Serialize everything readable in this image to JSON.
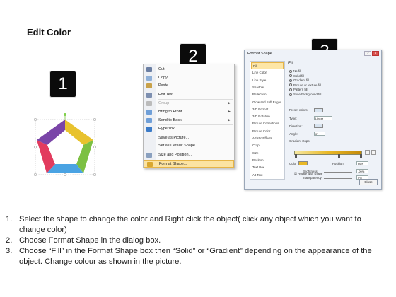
{
  "title": "Edit Color",
  "badges": [
    "1",
    "2",
    "3"
  ],
  "pentagon_colors": {
    "yellow": "#e8c22e",
    "green": "#7cc043",
    "blue": "#4aa3e3",
    "red": "#e23b5e",
    "purple": "#7a45a8",
    "center": "#ffffff"
  },
  "context_menu": {
    "items": [
      {
        "label": "Cut",
        "icon": "scissors-icon",
        "disabled": false,
        "submenu": false
      },
      {
        "label": "Copy",
        "icon": "copy-icon",
        "disabled": false,
        "submenu": false
      },
      {
        "label": "Paste",
        "icon": "paste-icon",
        "disabled": false,
        "submenu": false
      },
      {
        "label": "Edit Text",
        "icon": "edit-text-icon",
        "disabled": false,
        "submenu": false
      },
      {
        "label": "Group",
        "icon": "group-icon",
        "disabled": true,
        "submenu": true
      },
      {
        "label": "Bring to Front",
        "icon": "bring-front-icon",
        "disabled": false,
        "submenu": true
      },
      {
        "label": "Send to Back",
        "icon": "send-back-icon",
        "disabled": false,
        "submenu": true
      },
      {
        "label": "Hyperlink...",
        "icon": "hyperlink-icon",
        "disabled": false,
        "submenu": false
      },
      {
        "label": "Save as Picture...",
        "icon": "",
        "disabled": false,
        "submenu": false
      },
      {
        "label": "Set as Default Shape",
        "icon": "",
        "disabled": false,
        "submenu": false
      },
      {
        "label": "Size and Position...",
        "icon": "size-position-icon",
        "disabled": false,
        "submenu": false
      },
      {
        "label": "Format Shape...",
        "icon": "format-shape-icon",
        "disabled": false,
        "submenu": false,
        "highlighted": true
      }
    ]
  },
  "format_dialog": {
    "title": "Format Shape",
    "window_buttons": [
      "?",
      "X"
    ],
    "nav": [
      "Fill",
      "Line Color",
      "Line Style",
      "Shadow",
      "Reflection",
      "Glow and Soft Edges",
      "3-D Format",
      "3-D Rotation",
      "Picture Corrections",
      "Picture Color",
      "Artistic Effects",
      "Crop",
      "Size",
      "Position",
      "Text Box",
      "Alt Text"
    ],
    "selected_nav": "Fill",
    "pane_title": "Fill",
    "fill_options": [
      "No fill",
      "Solid fill",
      "Gradient fill",
      "Picture or texture fill",
      "Pattern fill",
      "Slide background fill"
    ],
    "selected_fill": "Gradient fill",
    "preset_label": "Preset colors:",
    "type_label": "Type:",
    "type_value": "Linear",
    "direction_label": "Direction:",
    "angle_label": "Angle:",
    "angle_value": "0°",
    "gradient_stops_label": "Gradient stops",
    "color_label": "Color",
    "position_label": "Position:",
    "position_value": "66%",
    "brightness_label": "Brightness:",
    "brightness_value": "-20%",
    "transparency_label": "Transparency:",
    "transparency_value": "0%",
    "rotate_label": "Rotate with shape",
    "close_label": "Close"
  },
  "instructions": [
    {
      "num": "1.",
      "text": "Select the shape to change the color and Right click the object( click any object which you want to change color)"
    },
    {
      "num": "2.",
      "text": "Choose Format Shape in the dialog box."
    },
    {
      "num": "3.",
      "text": "Choose “Fill” in the Format Shape box then “Solid” or “Gradient” depending on the appearance of the object. Change colour as shown in the picture."
    }
  ]
}
